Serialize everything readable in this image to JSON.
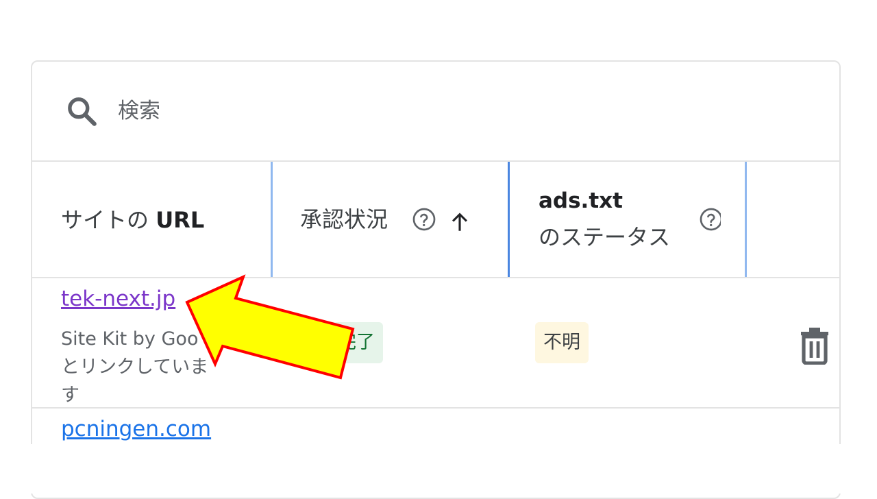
{
  "search": {
    "placeholder": "検索",
    "icon": "search-icon"
  },
  "table": {
    "columns": [
      {
        "label_pre": "サイトの ",
        "label_bold": "URL"
      },
      {
        "label": "承認状況",
        "help_icon": "help-circle-icon",
        "sort_icon": "arrow-up-icon"
      },
      {
        "label_line1": "ads.txt",
        "label_line2": "のステータス",
        "help_icon": "help-circle-icon"
      }
    ],
    "rows": [
      {
        "site": "tek-next.jp",
        "subtext_line1": "Site Kit by Goo",
        "subtext_line2": "とリンクしていま",
        "subtext_line3": "す",
        "approval": "完了",
        "ads_status": "不明",
        "delete_icon": "trash-icon"
      },
      {
        "site": "pcningen.com"
      }
    ]
  },
  "annotation": {
    "color": "#ffff00",
    "stroke": "#ff0000",
    "icon": "arrow-pointer-annotation"
  },
  "colors": {
    "visited_link": "#7b36c9",
    "link": "#1a73e8",
    "status_ok_bg": "#e6f4ea",
    "status_unknown_bg": "#fef7e0"
  }
}
